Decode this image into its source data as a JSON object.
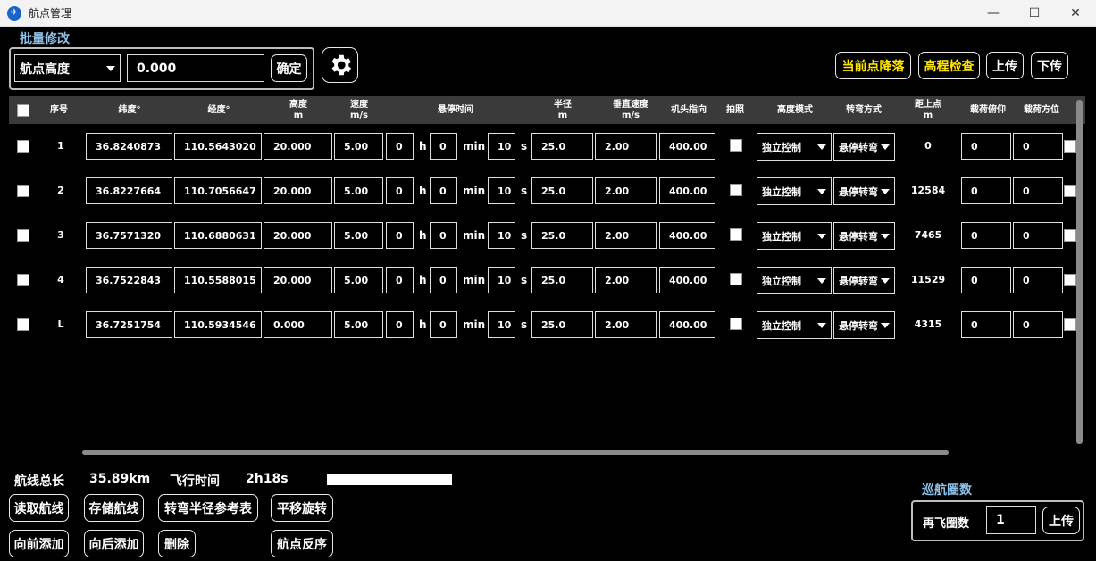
{
  "window": {
    "title": "航点管理",
    "icon": "app-logo-icon",
    "controls": [
      "minimize-icon",
      "maximize-icon",
      "close-icon"
    ]
  },
  "batch": {
    "title": "批量修改",
    "field": "航点高度",
    "value": "0.000",
    "confirm": "确定",
    "settings_icon": "gear-icon"
  },
  "top_buttons": {
    "land": "当前点降落",
    "elevation": "高程检查",
    "upload": "上传",
    "download": "下传"
  },
  "columns": {
    "seq": "序号",
    "lat": "纬度°",
    "lon": "经度°",
    "height": "高度",
    "height_unit": "m",
    "speed": "速度",
    "speed_unit": "m/s",
    "hover": "悬停时间",
    "radius": "半径",
    "radius_unit": "m",
    "vspeed": "垂直速度",
    "vspeed_unit": "m/s",
    "heading": "机头指向",
    "photo": "拍照",
    "alt_mode": "高度模式",
    "turn": "转弯方式",
    "dist": "距上点",
    "dist_unit": "m",
    "pitch": "载荷俯仰",
    "azimuth": "载荷方位"
  },
  "units": {
    "h": "h",
    "min": "min",
    "s": "s"
  },
  "rows": [
    {
      "seq": "1",
      "lat": "36.8240873",
      "lon": "110.5643020",
      "height": "20.000",
      "speed": "5.00",
      "hh": "0",
      "mm": "0",
      "ss": "10",
      "radius": "25.0",
      "vspeed": "2.00",
      "heading": "400.00",
      "alt_mode": "独立控制",
      "turn": "悬停转弯",
      "dist": "0",
      "pitch": "0",
      "azimuth": "0"
    },
    {
      "seq": "2",
      "lat": "36.8227664",
      "lon": "110.7056647",
      "height": "20.000",
      "speed": "5.00",
      "hh": "0",
      "mm": "0",
      "ss": "10",
      "radius": "25.0",
      "vspeed": "2.00",
      "heading": "400.00",
      "alt_mode": "独立控制",
      "turn": "悬停转弯",
      "dist": "12584",
      "pitch": "0",
      "azimuth": "0"
    },
    {
      "seq": "3",
      "lat": "36.7571320",
      "lon": "110.6880631",
      "height": "20.000",
      "speed": "5.00",
      "hh": "0",
      "mm": "0",
      "ss": "10",
      "radius": "25.0",
      "vspeed": "2.00",
      "heading": "400.00",
      "alt_mode": "独立控制",
      "turn": "悬停转弯",
      "dist": "7465",
      "pitch": "0",
      "azimuth": "0"
    },
    {
      "seq": "4",
      "lat": "36.7522843",
      "lon": "110.5588015",
      "height": "20.000",
      "speed": "5.00",
      "hh": "0",
      "mm": "0",
      "ss": "10",
      "radius": "25.0",
      "vspeed": "2.00",
      "heading": "400.00",
      "alt_mode": "独立控制",
      "turn": "悬停转弯",
      "dist": "11529",
      "pitch": "0",
      "azimuth": "0"
    },
    {
      "seq": "L",
      "lat": "36.7251754",
      "lon": "110.5934546",
      "height": "0.000",
      "speed": "5.00",
      "hh": "0",
      "mm": "0",
      "ss": "10",
      "radius": "25.0",
      "vspeed": "2.00",
      "heading": "400.00",
      "alt_mode": "独立控制",
      "turn": "悬停转弯",
      "dist": "4315",
      "pitch": "0",
      "azimuth": "0"
    }
  ],
  "summary": {
    "length_label": "航线总长",
    "length": "35.89km",
    "time_label": "飞行时间",
    "time": "2h18s"
  },
  "bottom_buttons": {
    "read": "读取航线",
    "save": "存储航线",
    "radius_ref": "转弯半径参考表",
    "move": "平移旋转",
    "add_before": "向前添加",
    "add_after": "向后添加",
    "delete": "删除",
    "reverse": "航点反序"
  },
  "cruise": {
    "title": "巡航圈数",
    "label": "再飞圈数",
    "value": "1",
    "upload": "上传"
  }
}
